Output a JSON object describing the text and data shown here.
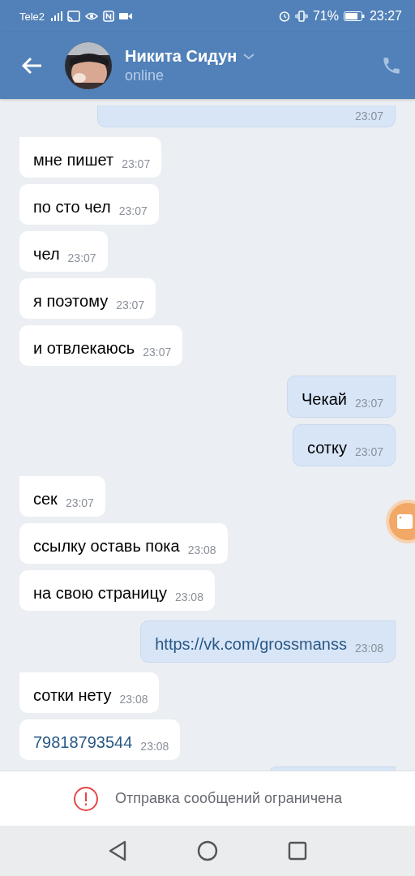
{
  "status_bar": {
    "carrier": "Tele2",
    "battery": "71%",
    "time": "23:27"
  },
  "header": {
    "name": "Никита Сидун",
    "status": "online"
  },
  "messages": [
    {
      "outgoing": true,
      "time": "23:07",
      "kind": "cut"
    },
    {
      "outgoing": false,
      "text": "мне пишет",
      "time": "23:07"
    },
    {
      "outgoing": false,
      "text": "по сто чел",
      "time": "23:07"
    },
    {
      "outgoing": false,
      "text": "чел",
      "time": "23:07"
    },
    {
      "outgoing": false,
      "text": "я поэтому",
      "time": "23:07"
    },
    {
      "outgoing": false,
      "text": "и отвлекаюсь",
      "time": "23:07"
    },
    {
      "outgoing": true,
      "text": "Чекай",
      "time": "23:07"
    },
    {
      "outgoing": true,
      "text": "сотку",
      "time": "23:07"
    },
    {
      "outgoing": false,
      "text": "сек",
      "time": "23:07"
    },
    {
      "outgoing": false,
      "text": "ссылку оставь пока",
      "time": "23:08"
    },
    {
      "outgoing": false,
      "text": "на свою страницу",
      "time": "23:08"
    },
    {
      "outgoing": true,
      "text": "https://vk.com/grossmanss",
      "time": "23:08",
      "kind": "link"
    },
    {
      "outgoing": false,
      "text": "сотки нету",
      "time": "23:08"
    },
    {
      "outgoing": false,
      "text": "79818793544",
      "time": "23:08",
      "kind": "link"
    },
    {
      "outgoing": true,
      "kind": "cut"
    }
  ],
  "notice": {
    "text": "Отправка сообщений ограничена"
  }
}
